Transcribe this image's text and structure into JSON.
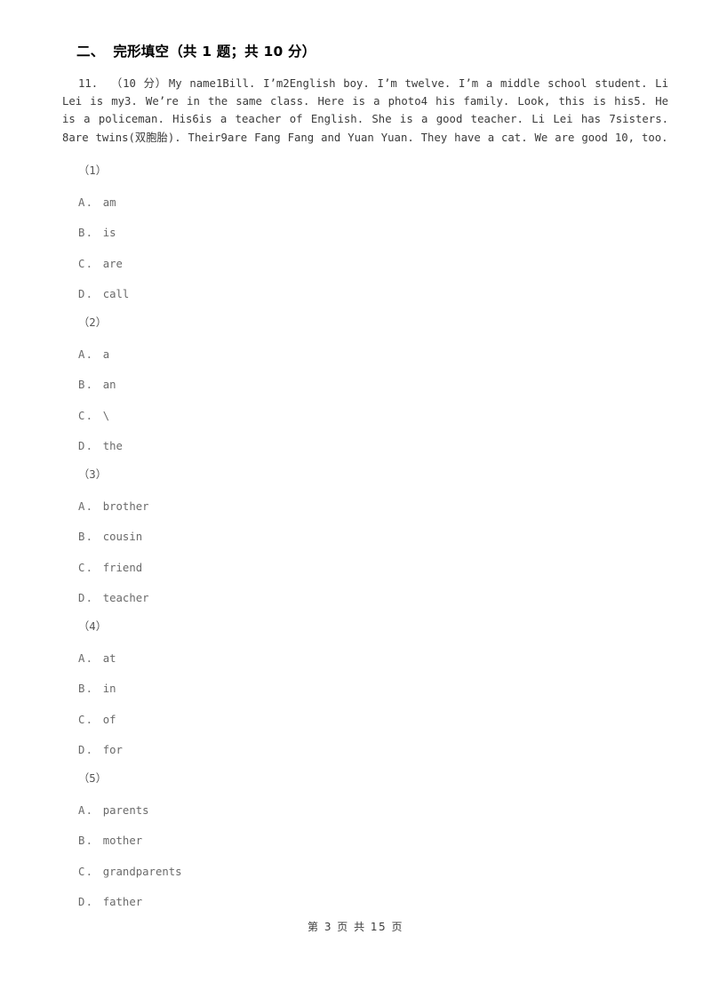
{
  "document": {
    "section": {
      "number": "二、",
      "title": "完形填空（共 1 题；共 10 分）"
    },
    "question": {
      "number": "11.",
      "score": "（10 分）",
      "passage": "My name1Bill. I’m2English boy. I’m twelve. I’m a middle school student. Li Lei is my3. We’re in the same class. Here is a photo4 his family. Look, this is his5. He is a policeman. His6is a teacher of English. She is a good teacher. Li Lei has  7sisters. 8are twins(双胞胎). Their9are Fang Fang and Yuan Yuan. They have a cat. We are good 10, too."
    },
    "blanks": [
      {
        "label": "（1）",
        "options": [
          {
            "key": "A",
            "dot": "．",
            "text": "am"
          },
          {
            "key": "B",
            "dot": "．",
            "text": "is"
          },
          {
            "key": "C",
            "dot": "．",
            "text": "are"
          },
          {
            "key": "D",
            "dot": "．",
            "text": "call"
          }
        ]
      },
      {
        "label": "（2）",
        "options": [
          {
            "key": "A",
            "dot": "．",
            "text": "a"
          },
          {
            "key": "B",
            "dot": "．",
            "text": "an"
          },
          {
            "key": "C",
            "dot": "．",
            "text": "\\"
          },
          {
            "key": "D",
            "dot": "．",
            "text": "the"
          }
        ]
      },
      {
        "label": "（3）",
        "options": [
          {
            "key": "A",
            "dot": "．",
            "text": "brother"
          },
          {
            "key": "B",
            "dot": "．",
            "text": "cousin"
          },
          {
            "key": "C",
            "dot": "．",
            "text": "friend"
          },
          {
            "key": "D",
            "dot": "．",
            "text": "teacher"
          }
        ]
      },
      {
        "label": "（4）",
        "options": [
          {
            "key": "A",
            "dot": "．",
            "text": "at"
          },
          {
            "key": "B",
            "dot": "．",
            "text": "in"
          },
          {
            "key": "C",
            "dot": "．",
            "text": "of"
          },
          {
            "key": "D",
            "dot": "．",
            "text": "for"
          }
        ]
      },
      {
        "label": "（5）",
        "options": [
          {
            "key": "A",
            "dot": "．",
            "text": "parents"
          },
          {
            "key": "B",
            "dot": "．",
            "text": "mother"
          },
          {
            "key": "C",
            "dot": "．",
            "text": "grandparents"
          },
          {
            "key": "D",
            "dot": "．",
            "text": "father"
          }
        ]
      }
    ],
    "footer": {
      "text": "第 3 页 共 15 页"
    }
  },
  "colors": {
    "page_background": "#ffffff",
    "heading_text": "#000000",
    "body_text": "#3a3a3a",
    "option_text": "#6a6a6a",
    "footer_text": "#3c3c3c"
  }
}
